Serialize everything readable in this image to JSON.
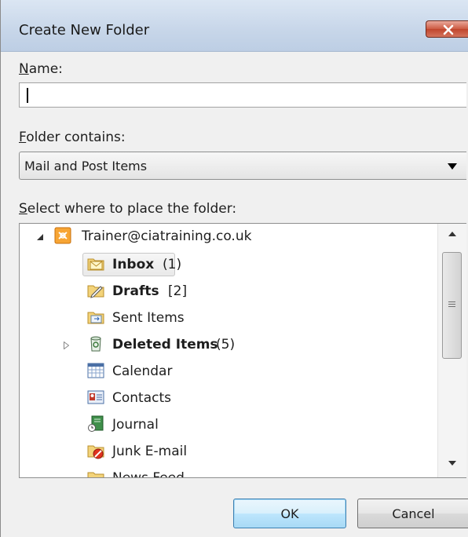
{
  "window": {
    "title": "Create New Folder",
    "close_icon": "close-icon"
  },
  "name_field": {
    "label_key": "N",
    "label_rest": "ame:",
    "value": ""
  },
  "folder_contains": {
    "label_key": "F",
    "label_rest": "older contains:",
    "selected": "Mail and Post Items"
  },
  "location": {
    "label_key": "S",
    "label_rest": "elect where to place the folder:"
  },
  "tree": {
    "account": {
      "label": "Trainer@ciatraining.co.uk",
      "icon": "data-file-icon",
      "expanded": true
    },
    "items": [
      {
        "label": "Inbox",
        "count": "(1)",
        "icon": "inbox-folder-icon",
        "bold": true,
        "selected": true
      },
      {
        "label": "Drafts",
        "count": "[2]",
        "icon": "drafts-folder-icon",
        "bold": true
      },
      {
        "label": "Sent Items",
        "count": "",
        "icon": "sent-items-folder-icon",
        "bold": false
      },
      {
        "label": "Deleted Items",
        "count": "(5)",
        "icon": "deleted-items-icon",
        "bold": true,
        "collapsed_children": true
      },
      {
        "label": "Calendar",
        "count": "",
        "icon": "calendar-icon",
        "bold": false
      },
      {
        "label": "Contacts",
        "count": "",
        "icon": "contacts-icon",
        "bold": false
      },
      {
        "label": "Journal",
        "count": "",
        "icon": "journal-icon",
        "bold": false
      },
      {
        "label": "Junk E-mail",
        "count": "",
        "icon": "junk-email-folder-icon",
        "bold": false
      },
      {
        "label": "News Feed",
        "count": "",
        "icon": "news-feed-folder-icon",
        "bold": false
      }
    ]
  },
  "buttons": {
    "ok": "OK",
    "cancel": "Cancel"
  },
  "colors": {
    "unread_count": "#1a3fd6",
    "draft_count": "#2a8c2a",
    "close_button": "#c0452c"
  }
}
